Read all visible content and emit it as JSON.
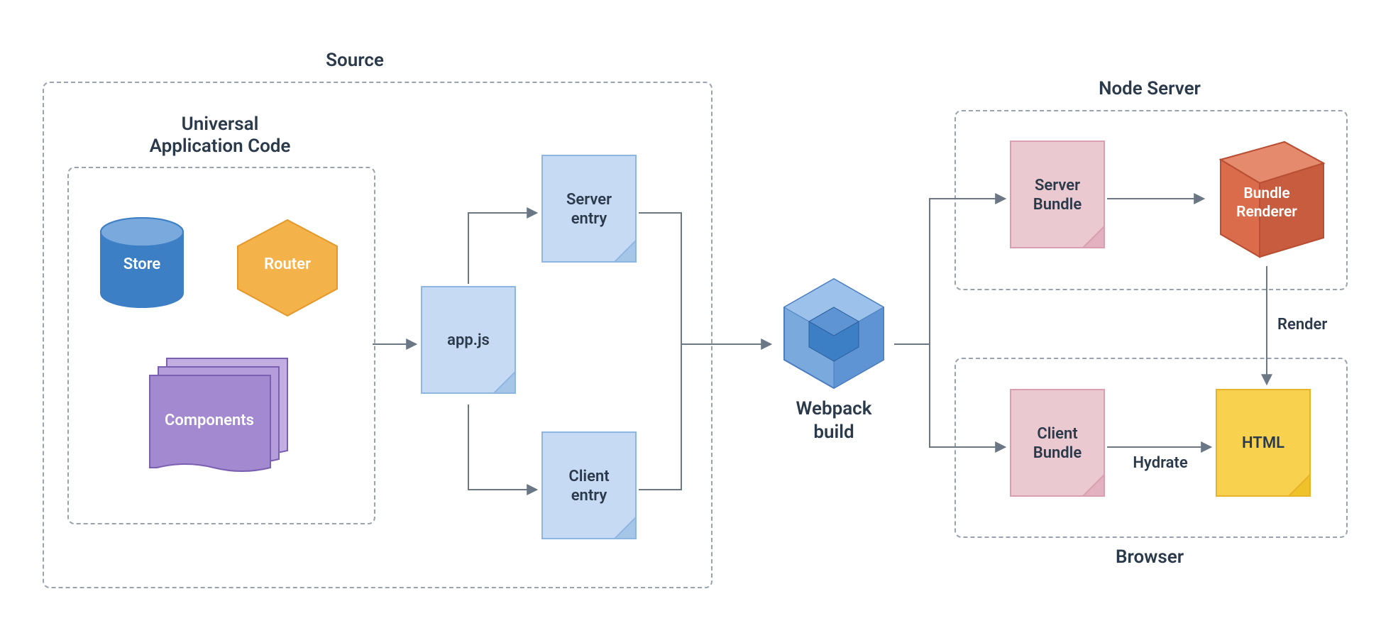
{
  "titles": {
    "source": "Source",
    "universal": "Universal\nApplication Code",
    "nodeServer": "Node Server",
    "browser": "Browser",
    "webpack": "Webpack\nbuild"
  },
  "nodes": {
    "store": "Store",
    "router": "Router",
    "components": "Components",
    "appjs": "app.js",
    "serverEntry": "Server\nentry",
    "clientEntry": "Client\nentry",
    "serverBundle": "Server\nBundle",
    "clientBundle": "Client\nBundle",
    "bundleRenderer": "Bundle\nRenderer",
    "html": "HTML"
  },
  "edges": {
    "render": "Render",
    "hydrate": "Hydrate"
  },
  "colors": {
    "blueFill": "#c6dbf3",
    "blueStroke": "#8db6e2",
    "blueDark": "#3d7fc4",
    "blueMid": "#7aa9dd",
    "orangeFill": "#f4b34a",
    "orangeStroke": "#e5982a",
    "purpleFill": "#a389cf",
    "purpleStroke": "#7b5fb0",
    "pinkFill": "#eac9d1",
    "pinkStroke": "#d99fb0",
    "redFill": "#da6c4c",
    "redStroke": "#b84f33",
    "yellowFill": "#f8d24f",
    "yellowStroke": "#e6b329",
    "gray": "#6b7785"
  }
}
